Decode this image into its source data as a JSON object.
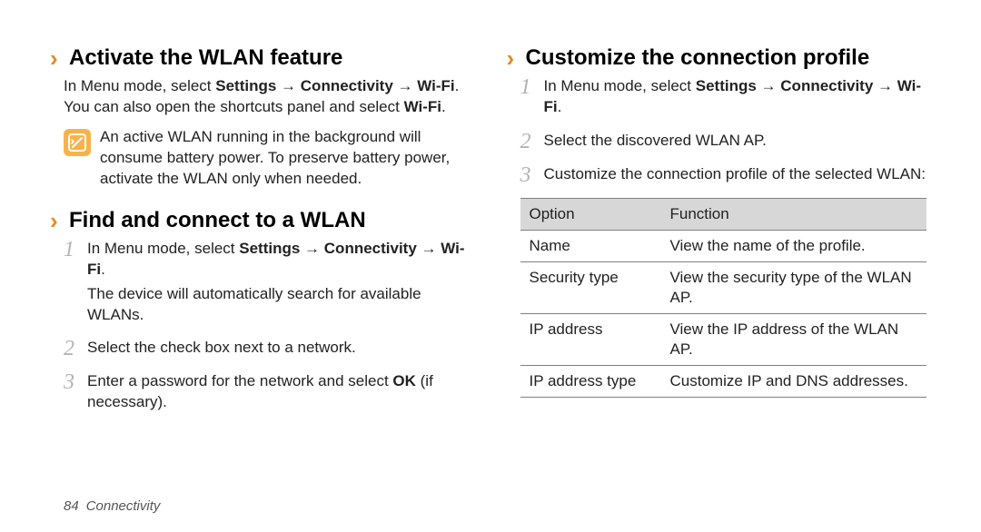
{
  "left": {
    "section1": {
      "title": "Activate the WLAN feature",
      "para1_pre": "In Menu mode, select ",
      "para1_b1": "Settings",
      "arrow": " → ",
      "para1_b2": "Connectivity",
      "para1_b3": "Wi-Fi",
      "para1_post": ". You can also open the shortcuts panel and select ",
      "para1_b4": "Wi-Fi",
      "para1_end": ".",
      "note": "An active WLAN running in the background will consume battery power. To preserve battery power, activate the WLAN only when needed."
    },
    "section2": {
      "title": "Find and connect to a WLAN",
      "step1_pre": "In Menu mode, select ",
      "step1_b1": "Settings",
      "step1_b2": "Connectivity",
      "step1_b3": "Wi-Fi",
      "step1_post": ".",
      "step1_sub": "The device will automatically search for available WLANs.",
      "step2": "Select the check box next to a network.",
      "step3_pre": "Enter a password for the network and select ",
      "step3_b": "OK",
      "step3_post": " (if necessary)."
    }
  },
  "right": {
    "title": "Customize the connection profile",
    "step1_pre": "In Menu mode, select ",
    "step1_b1": "Settings",
    "step1_b2": "Connectivity",
    "step1_b3": "Wi-Fi",
    "step1_post": ".",
    "step2": "Select the discovered WLAN AP.",
    "step3": "Customize the connection profile of the selected WLAN:",
    "table": {
      "head_option": "Option",
      "head_function": "Function",
      "rows": [
        {
          "option": "Name",
          "func": "View the name of the profile."
        },
        {
          "option": "Security type",
          "func": "View the security type of the WLAN AP."
        },
        {
          "option": "IP address",
          "func": "View the IP address of the WLAN AP."
        },
        {
          "option": "IP address type",
          "func": "Customize IP and DNS addresses."
        }
      ]
    }
  },
  "footer": {
    "page_no": "84",
    "section": "Connectivity"
  },
  "numerals": {
    "n1": "1",
    "n2": "2",
    "n3": "3"
  },
  "chevron": "›"
}
